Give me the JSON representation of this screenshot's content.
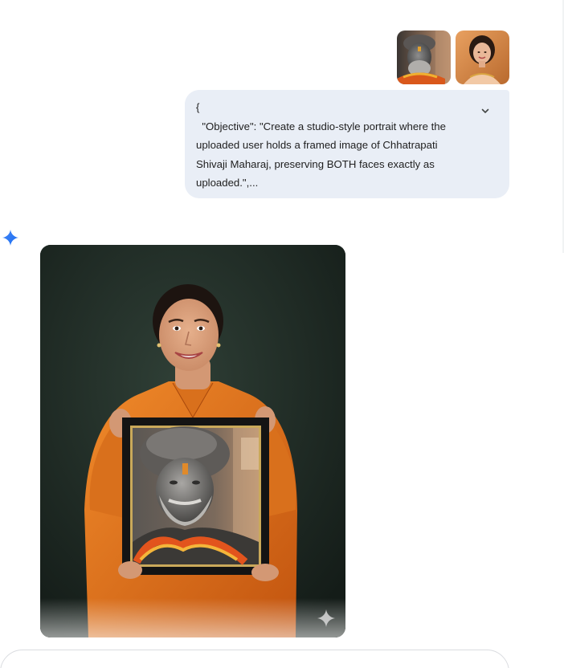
{
  "conversation": {
    "user_message": {
      "attachments": [
        {
          "name": "shivaji-maharaj-statue",
          "description_icon": "image-thumbnail"
        },
        {
          "name": "woman-portrait",
          "description_icon": "image-thumbnail"
        }
      ],
      "prompt_lines": [
        "{",
        "  \"Objective\": \"Create a studio-style portrait where the",
        "uploaded user holds a framed image of Chhatrapati",
        "Shivaji Maharaj, preserving BOTH faces exactly as",
        "uploaded.\",..."
      ],
      "expand_icon": "chevron-down-icon"
    },
    "model_response": {
      "avatar_icon": "gemini-spark-icon",
      "image_watermark_icon": "sparkle-icon"
    }
  },
  "colors": {
    "bubble_bg": "#e9eef6",
    "spark_blue": "#4285f4",
    "image_bg": "#1c2620",
    "kurta_orange": "#e06a17"
  }
}
